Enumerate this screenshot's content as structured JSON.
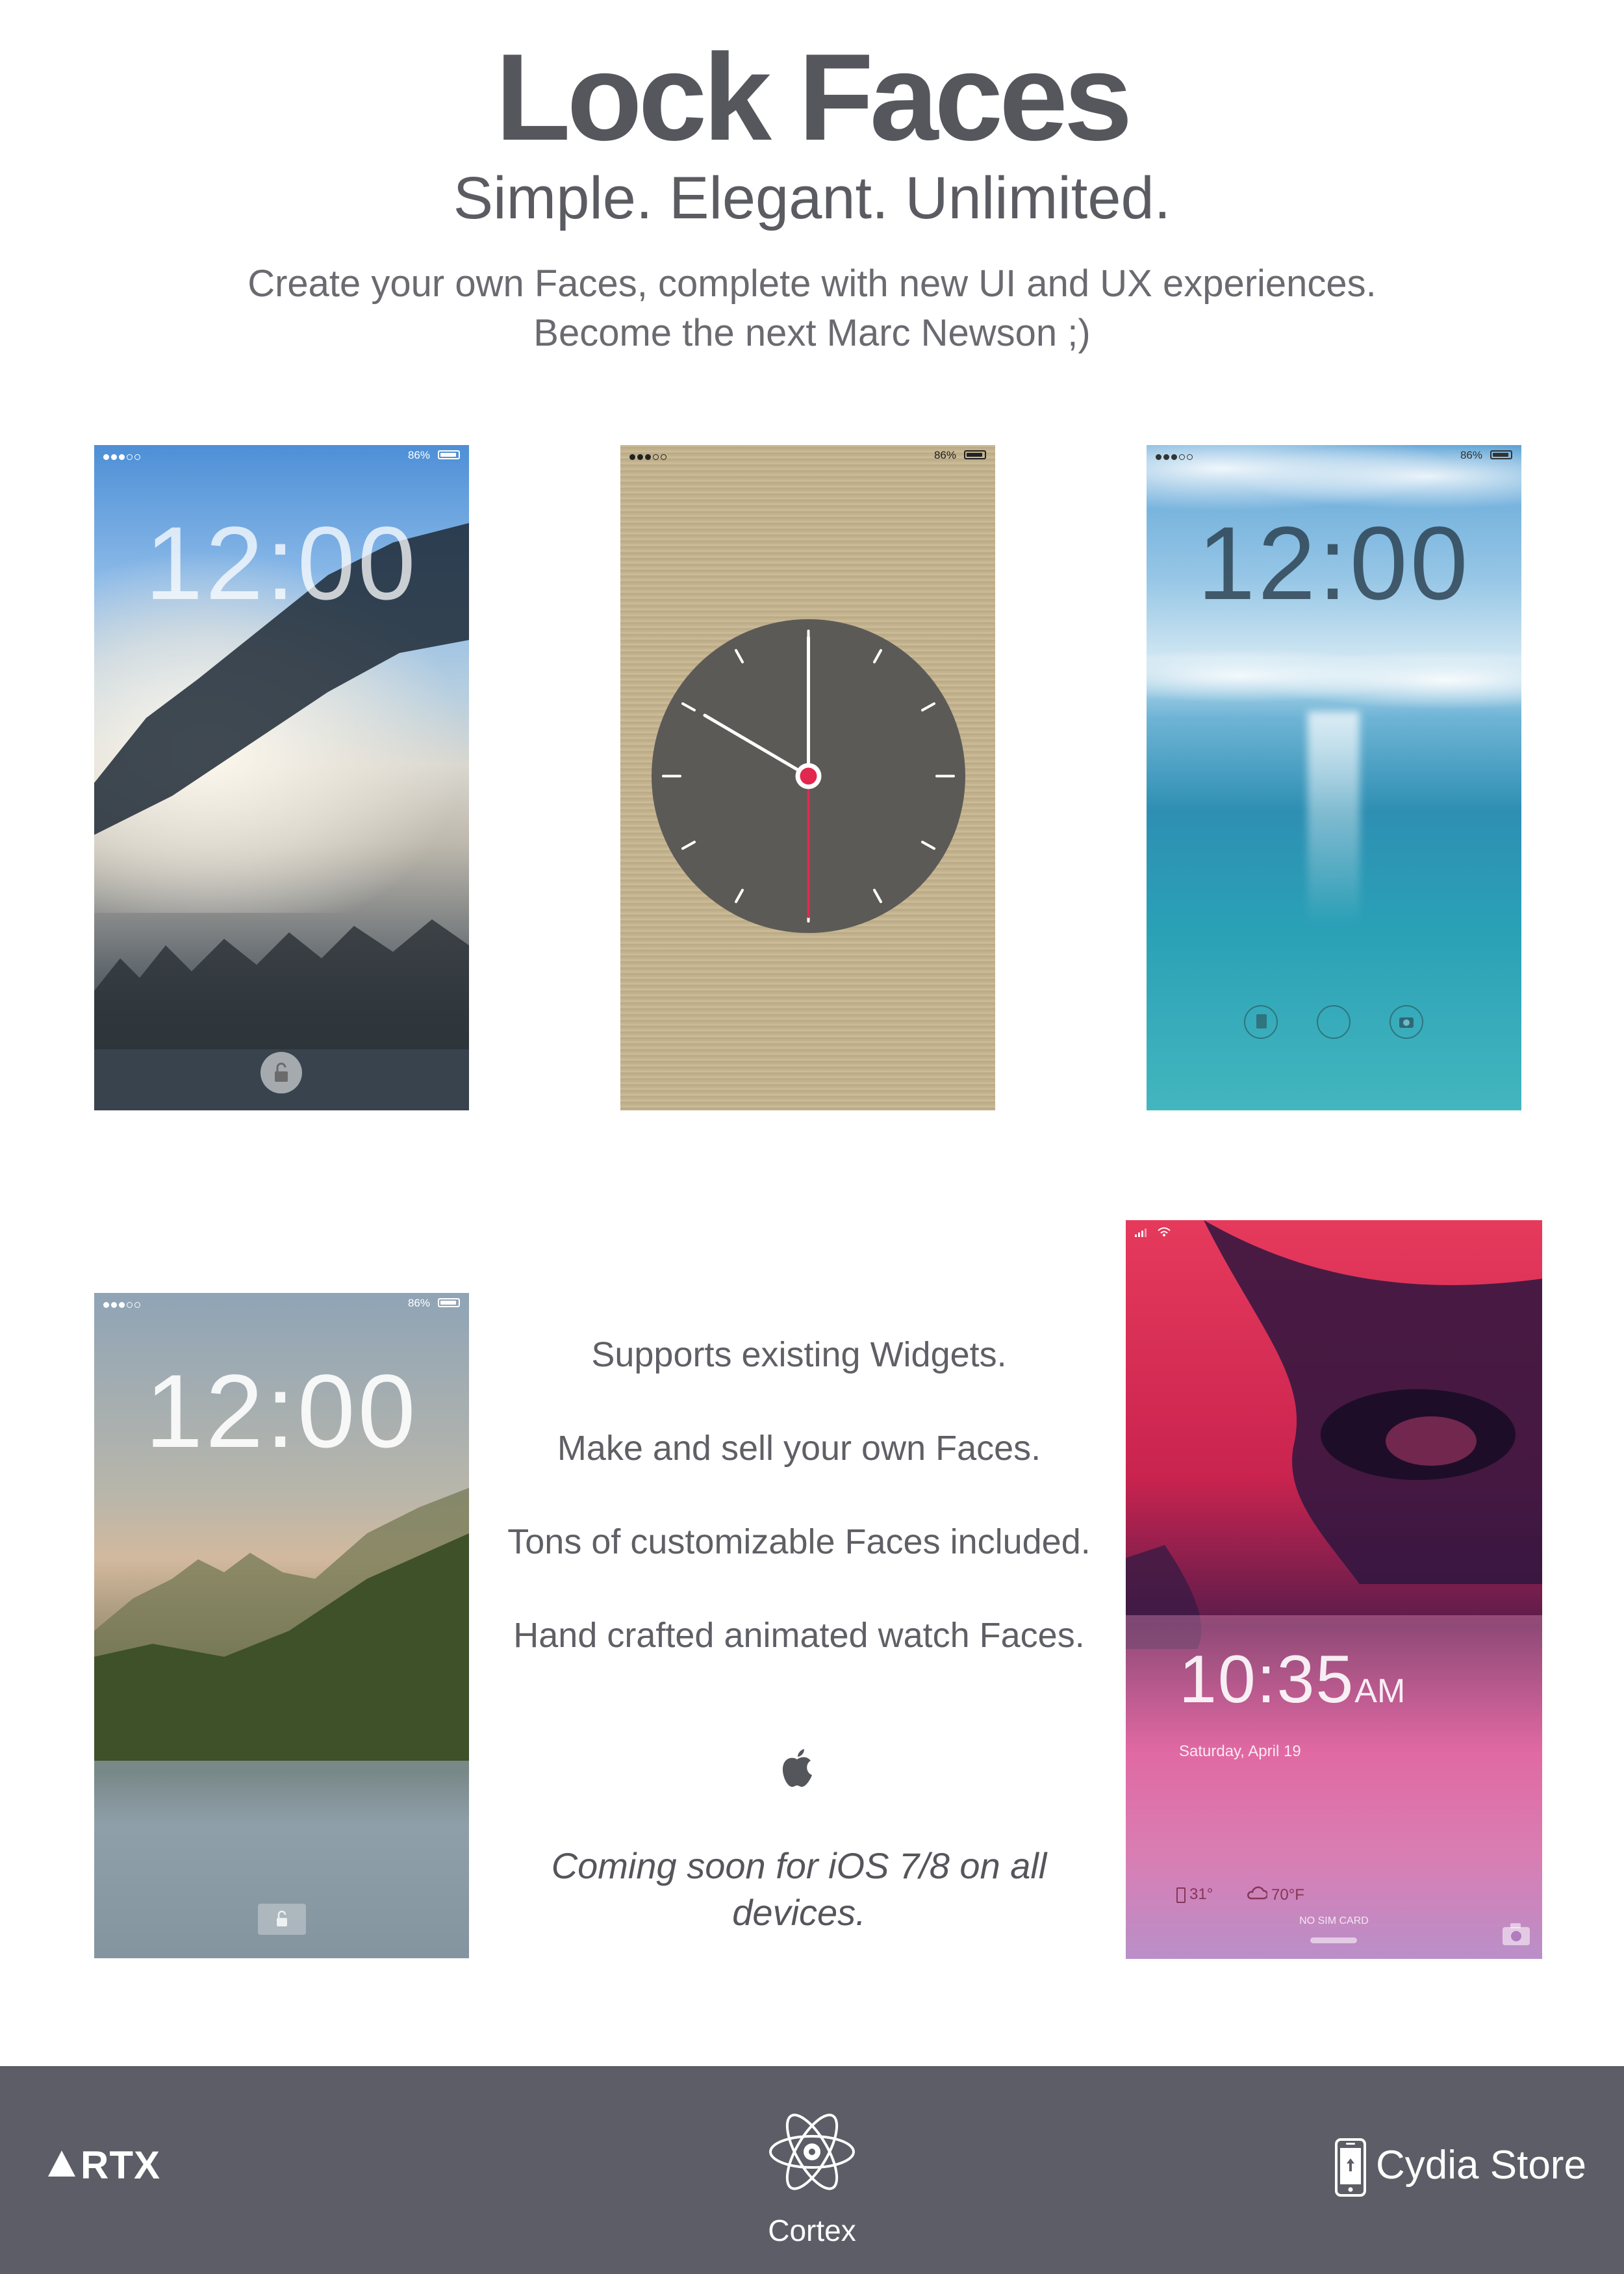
{
  "header": {
    "title": "Lock Faces",
    "tagline": "Simple.  Elegant.  Unlimited.",
    "description_line1": "Create your own Faces, complete with new UI and UX experiences.",
    "description_line2": "Become the next Marc Newson ;)"
  },
  "screens": {
    "fog_mountain": {
      "time": "12:00",
      "battery": "86%"
    },
    "analog_watch": {
      "battery": "86%"
    },
    "ocean": {
      "time": "12:00",
      "battery": "86%"
    },
    "lake_mountain": {
      "time": "12:00",
      "battery": "86%"
    },
    "face_closeup": {
      "time": "10:35",
      "ampm": "AM",
      "date": "Saturday, April 19",
      "battery_temp": "31°",
      "weather_temp": "70°F",
      "sim_status": "NO SIM CARD"
    }
  },
  "features": [
    "Supports existing Widgets.",
    "Make and sell your own Faces.",
    "Tons of customizable Faces included.",
    "Hand crafted animated watch Faces."
  ],
  "coming_soon": "Coming soon for iOS 7/8 on all devices.",
  "footer": {
    "left_brand": "RTX",
    "center_brand": "Cortex",
    "right_brand": "Cydia Store"
  },
  "colors": {
    "footer_bg": "#5d5d67",
    "title_text": "#56565d",
    "watch_face": "#5b5a57",
    "watch_accent": "#e2284e"
  },
  "icons": [
    "apple-logo-icon",
    "atom-icon",
    "iphone-icon",
    "lock-icon",
    "camera-icon",
    "triangle-icon"
  ]
}
